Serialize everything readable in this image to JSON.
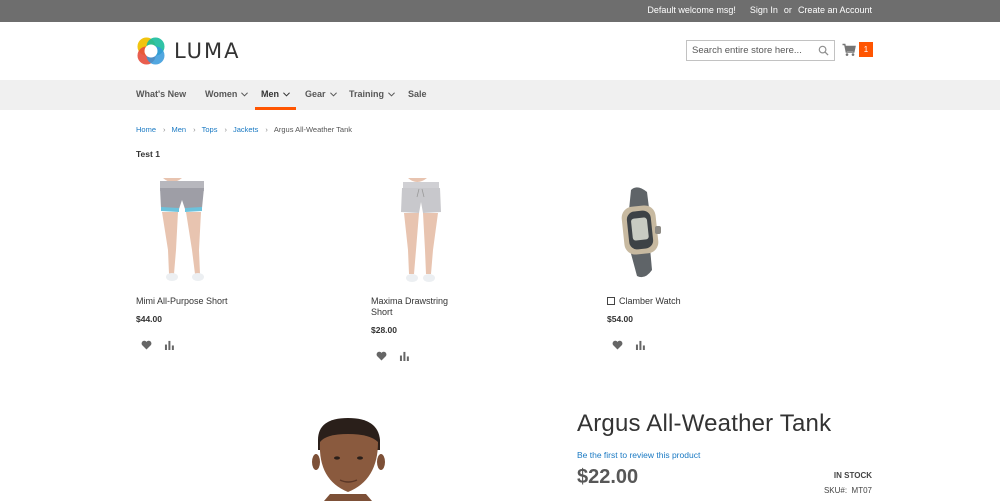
{
  "topbar": {
    "welcome": "Default welcome msg!",
    "sign_in": "Sign In",
    "or": "or",
    "create_account": "Create an Account"
  },
  "header": {
    "logo_text": "LUMA",
    "search_placeholder": "Search entire store here...",
    "cart_count": "1"
  },
  "nav": {
    "items": [
      {
        "label": "What's New",
        "has_menu": false
      },
      {
        "label": "Women",
        "has_menu": true
      },
      {
        "label": "Men",
        "has_menu": true,
        "active": true
      },
      {
        "label": "Gear",
        "has_menu": true
      },
      {
        "label": "Training",
        "has_menu": true
      },
      {
        "label": "Sale",
        "has_menu": false
      }
    ]
  },
  "breadcrumb": {
    "items": [
      "Home",
      "Men",
      "Tops",
      "Jackets"
    ],
    "current": "Argus All-Weather Tank"
  },
  "block": {
    "title": "Test 1"
  },
  "products": [
    {
      "name_line1": "Mimi All-Purpose Short",
      "name_line2": "",
      "price": "$44.00"
    },
    {
      "name_line1": "Maxima Drawstring",
      "name_line2": "Short",
      "price": "$28.00"
    },
    {
      "name_line1": "Clamber Watch",
      "name_line2": "",
      "price": "$54.00"
    }
  ],
  "product_detail": {
    "title": "Argus All-Weather Tank",
    "review_link": "Be the first to review this product",
    "price": "$22.00",
    "stock": "IN STOCK",
    "sku_label": "SKU#:",
    "sku": "MT07"
  },
  "colors": {
    "accent": "#ff5501",
    "link": "#1979c3",
    "topbar": "#6e6e6e",
    "nav_bg": "#f0f0f0"
  }
}
